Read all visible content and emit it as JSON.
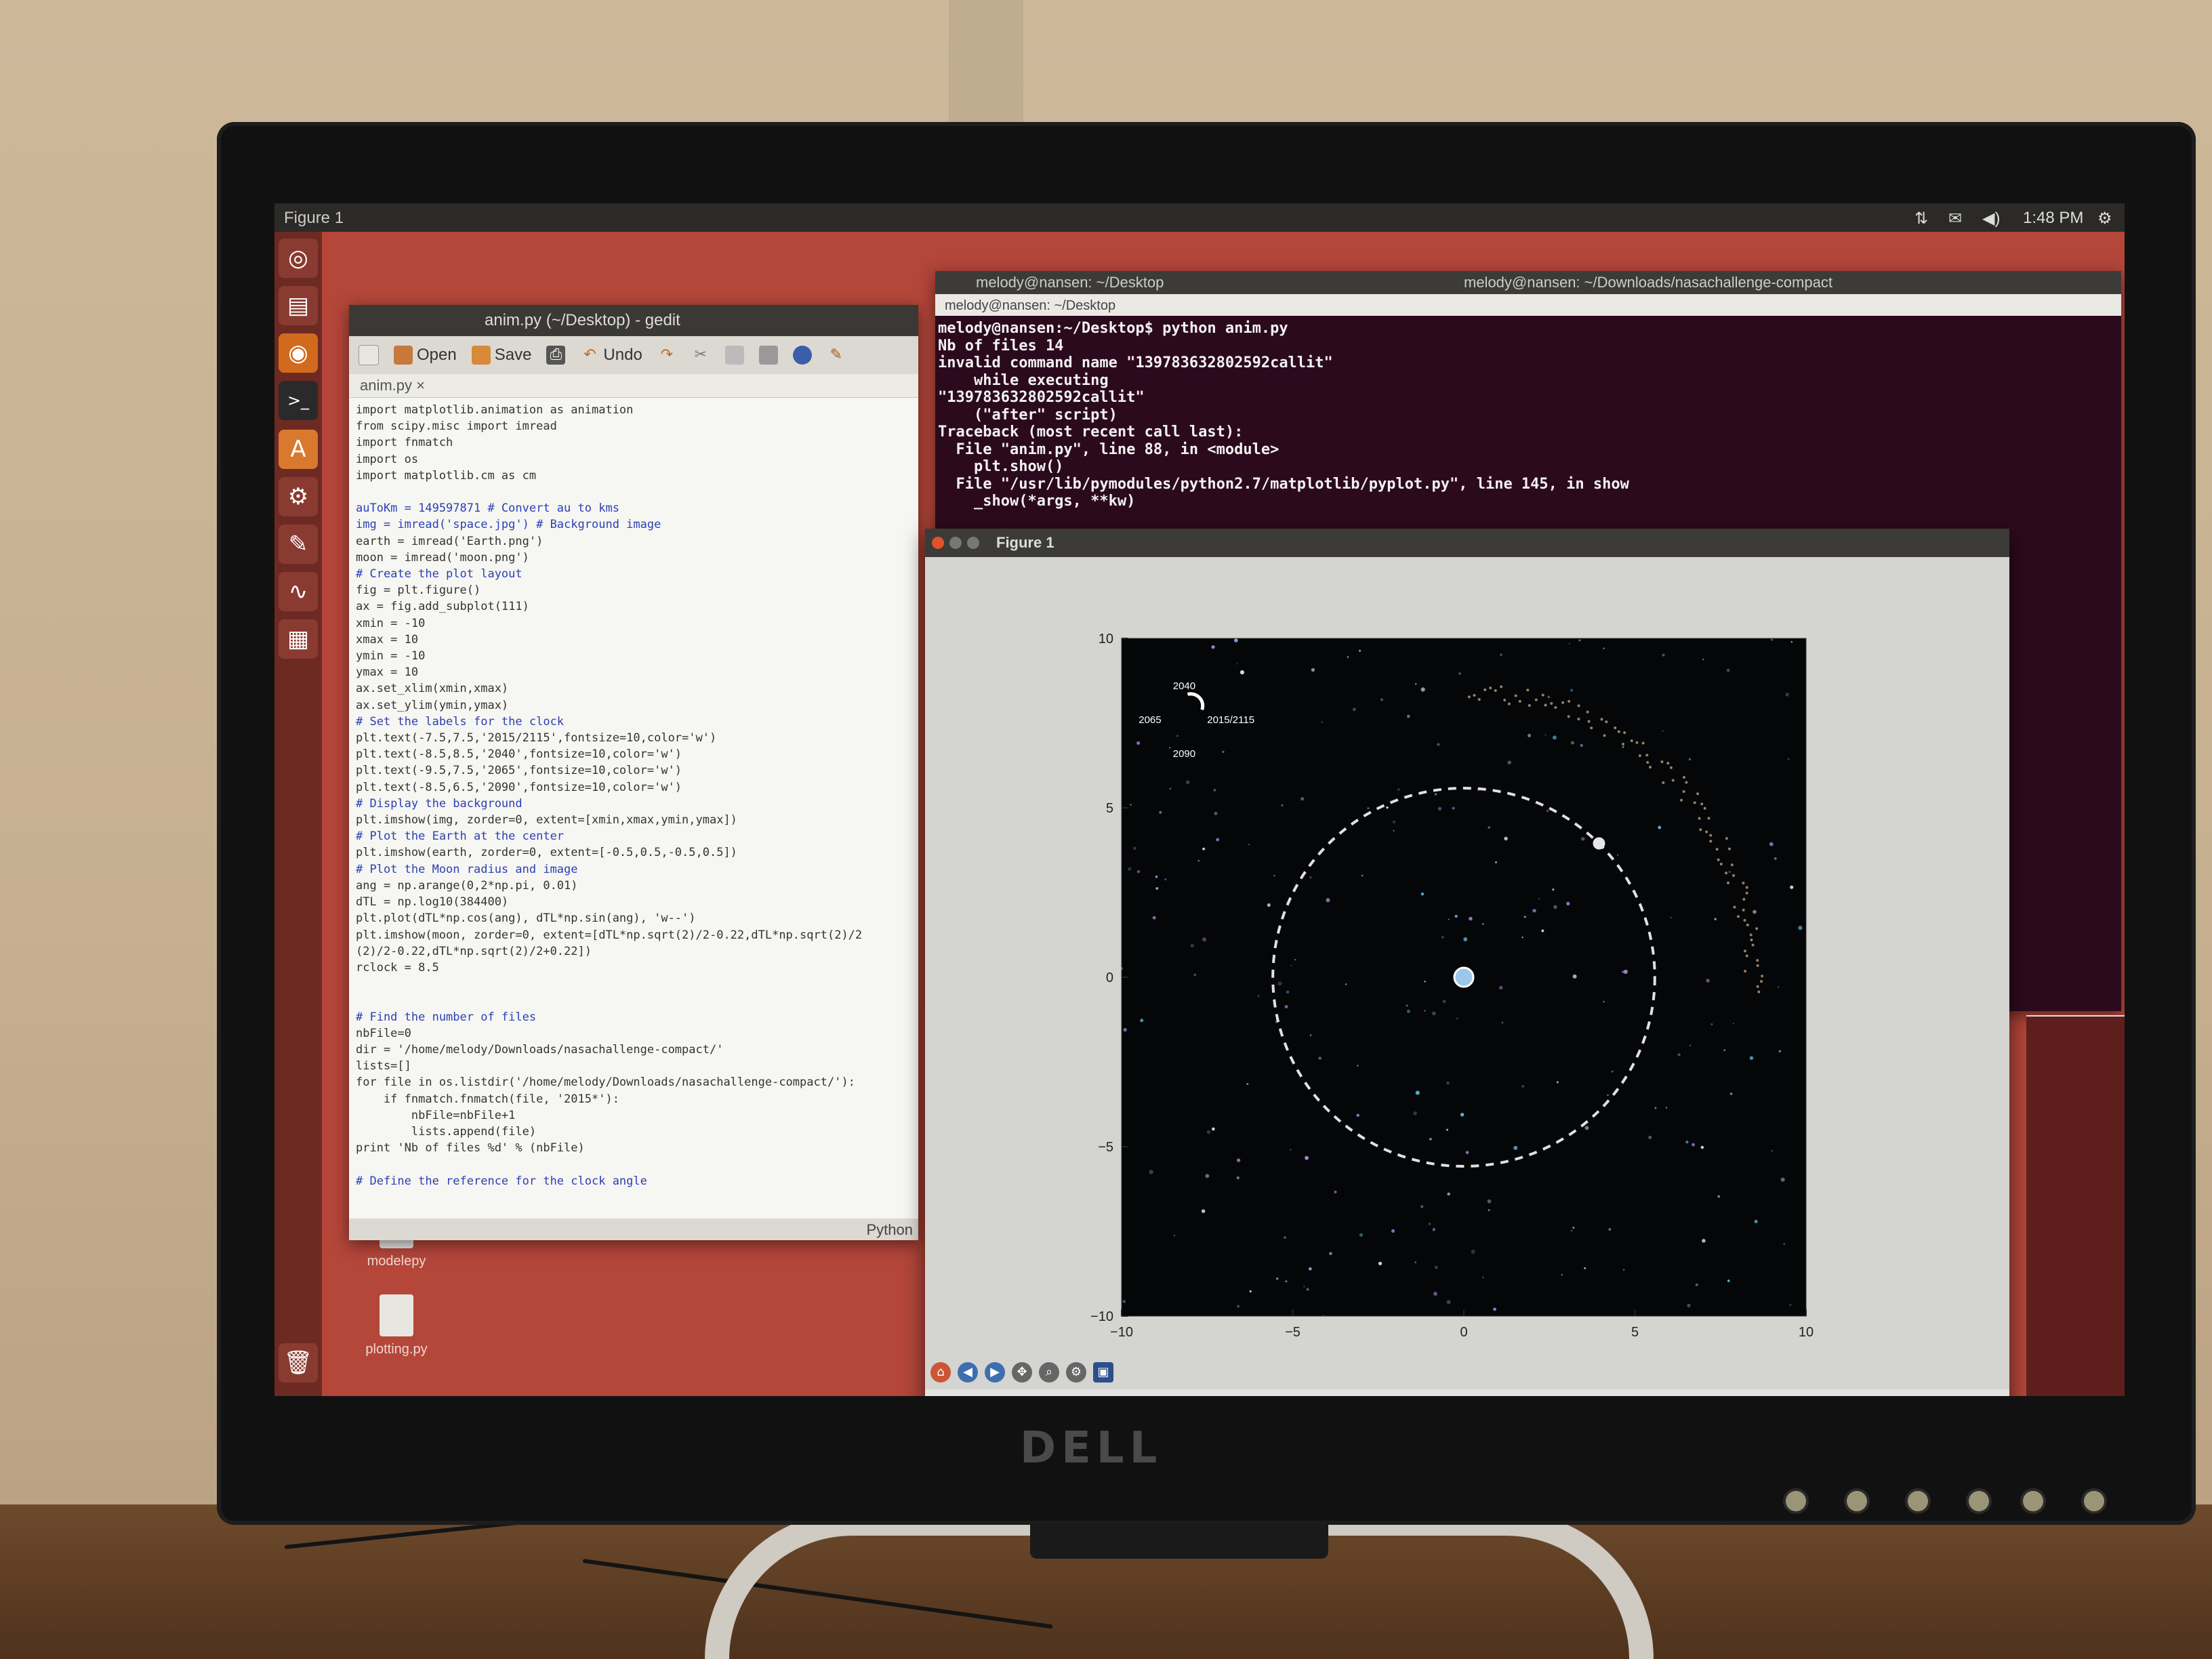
{
  "topbar": {
    "window_title": "Figure 1",
    "indicators": [
      "⇅",
      "✉",
      "◀)",
      "1:48 PM",
      "⚙"
    ]
  },
  "launcher": {
    "items": [
      {
        "name": "dash",
        "glyph": "◎"
      },
      {
        "name": "files",
        "glyph": "▤"
      },
      {
        "name": "firefox",
        "glyph": "◉"
      },
      {
        "name": "terminal",
        "glyph": ">_"
      },
      {
        "name": "software-center",
        "glyph": "A"
      },
      {
        "name": "settings",
        "glyph": "⚙"
      },
      {
        "name": "text-editor",
        "glyph": "✎"
      },
      {
        "name": "system-monitor",
        "glyph": "∿"
      },
      {
        "name": "workspaces",
        "glyph": "▦"
      },
      {
        "name": "trash",
        "glyph": "🗑"
      }
    ]
  },
  "gedit": {
    "title": "anim.py (~/Desktop) - gedit",
    "toolbar": {
      "open": "Open",
      "save": "Save",
      "undo": "Undo"
    },
    "tab": "anim.py ×",
    "status_lang": "Python",
    "code_lines": [
      {
        "t": "import matplotlib.animation as animation"
      },
      {
        "t": "from scipy.misc import imread"
      },
      {
        "t": "import fnmatch"
      },
      {
        "t": "import os"
      },
      {
        "t": "import matplotlib.cm as cm"
      },
      {
        "t": ""
      },
      {
        "t": "auToKm = 149597871 # Convert au to kms",
        "c": true
      },
      {
        "t": "img = imread('space.jpg') # Background image",
        "c": true
      },
      {
        "t": "earth = imread('Earth.png')"
      },
      {
        "t": "moon = imread('moon.png')"
      },
      {
        "t": "# Create the plot layout",
        "c": true
      },
      {
        "t": "fig = plt.figure()"
      },
      {
        "t": "ax = fig.add_subplot(111)"
      },
      {
        "t": "xmin = -10"
      },
      {
        "t": "xmax = 10"
      },
      {
        "t": "ymin = -10"
      },
      {
        "t": "ymax = 10"
      },
      {
        "t": "ax.set_xlim(xmin,xmax)"
      },
      {
        "t": "ax.set_ylim(ymin,ymax)"
      },
      {
        "t": "# Set the labels for the clock",
        "c": true
      },
      {
        "t": "plt.text(-7.5,7.5,'2015/2115',fontsize=10,color='w')"
      },
      {
        "t": "plt.text(-8.5,8.5,'2040',fontsize=10,color='w')"
      },
      {
        "t": "plt.text(-9.5,7.5,'2065',fontsize=10,color='w')"
      },
      {
        "t": "plt.text(-8.5,6.5,'2090',fontsize=10,color='w')"
      },
      {
        "t": "# Display the background",
        "c": true
      },
      {
        "t": "plt.imshow(img, zorder=0, extent=[xmin,xmax,ymin,ymax])"
      },
      {
        "t": "# Plot the Earth at the center",
        "c": true
      },
      {
        "t": "plt.imshow(earth, zorder=0, extent=[-0.5,0.5,-0.5,0.5])"
      },
      {
        "t": "# Plot the Moon radius and image",
        "c": true
      },
      {
        "t": "ang = np.arange(0,2*np.pi, 0.01)"
      },
      {
        "t": "dTL = np.log10(384400)"
      },
      {
        "t": "plt.plot(dTL*np.cos(ang), dTL*np.sin(ang), 'w--')"
      },
      {
        "t": "plt.imshow(moon, zorder=0, extent=[dTL*np.sqrt(2)/2-0.22,dTL*np.sqrt(2)/2"
      },
      {
        "t": "(2)/2-0.22,dTL*np.sqrt(2)/2+0.22])"
      },
      {
        "t": "rclock = 8.5"
      },
      {
        "t": ""
      },
      {
        "t": ""
      },
      {
        "t": "# Find the number of files",
        "c": true
      },
      {
        "t": "nbFile=0"
      },
      {
        "t": "dir = '/home/melody/Downloads/nasachallenge-compact/'"
      },
      {
        "t": "lists=[]"
      },
      {
        "t": "for file in os.listdir('/home/melody/Downloads/nasachallenge-compact/'):"
      },
      {
        "t": "    if fnmatch.fnmatch(file, '2015*'):"
      },
      {
        "t": "        nbFile=nbFile+1"
      },
      {
        "t": "        lists.append(file)"
      },
      {
        "t": "print 'Nb of files %d' % (nbFile)"
      },
      {
        "t": ""
      },
      {
        "t": "# Define the reference for the clock angle",
        "c": true
      }
    ]
  },
  "desktop": {
    "icons": [
      {
        "label": "modelepy"
      },
      {
        "label": "plotting.py"
      }
    ]
  },
  "terminal": {
    "title_left": "melody@nansen: ~/Desktop",
    "title_right": "melody@nansen: ~/Downloads/nasachallenge-compact",
    "tab_left": "melody@nansen: ~/Desktop",
    "lines": [
      "melody@nansen:~/Desktop$ python anim.py",
      "Nb of files 14",
      "invalid command name \"139783632802592callit\"",
      "    while executing",
      "\"139783632802592callit\"",
      "    (\"after\" script)",
      "Traceback (most recent call last):",
      "  File \"anim.py\", line 88, in <module>",
      "    plt.show()",
      "  File \"/usr/lib/pymodules/python2.7/matplotlib/pyplot.py\", line 145, in show",
      "    _show(*args, **kw)"
    ]
  },
  "figure": {
    "title": "Figure 1",
    "clock_labels": [
      "2040",
      "2065",
      "2015/2115",
      "2090"
    ],
    "toolbar": [
      "home",
      "back",
      "forward",
      "pan",
      "zoom",
      "configure",
      "save"
    ]
  },
  "monitor": {
    "brand": "DELL"
  },
  "colors": {
    "ubuntu_orange": "#b4463a",
    "terminal_bg": "#2c0a1e",
    "plot_bg": "#050608"
  },
  "chart_data": {
    "type": "scatter",
    "title": "",
    "xlabel": "",
    "ylabel": "",
    "xlim": [
      -10,
      10
    ],
    "ylim": [
      -10,
      10
    ],
    "xticks": [
      "−10",
      "−5",
      "0",
      "5",
      "10"
    ],
    "yticks": [
      "10",
      "5",
      "0",
      "−5",
      "−10"
    ],
    "grid": false,
    "series": [
      {
        "kind": "dashed-circle",
        "center": [
          0,
          0
        ],
        "radius": 5.58,
        "color": "#e0e0e0"
      },
      {
        "kind": "clock-arc",
        "center": [
          -8.0,
          8.0
        ],
        "radius": 0.35,
        "color": "#ffffff"
      }
    ]
  }
}
